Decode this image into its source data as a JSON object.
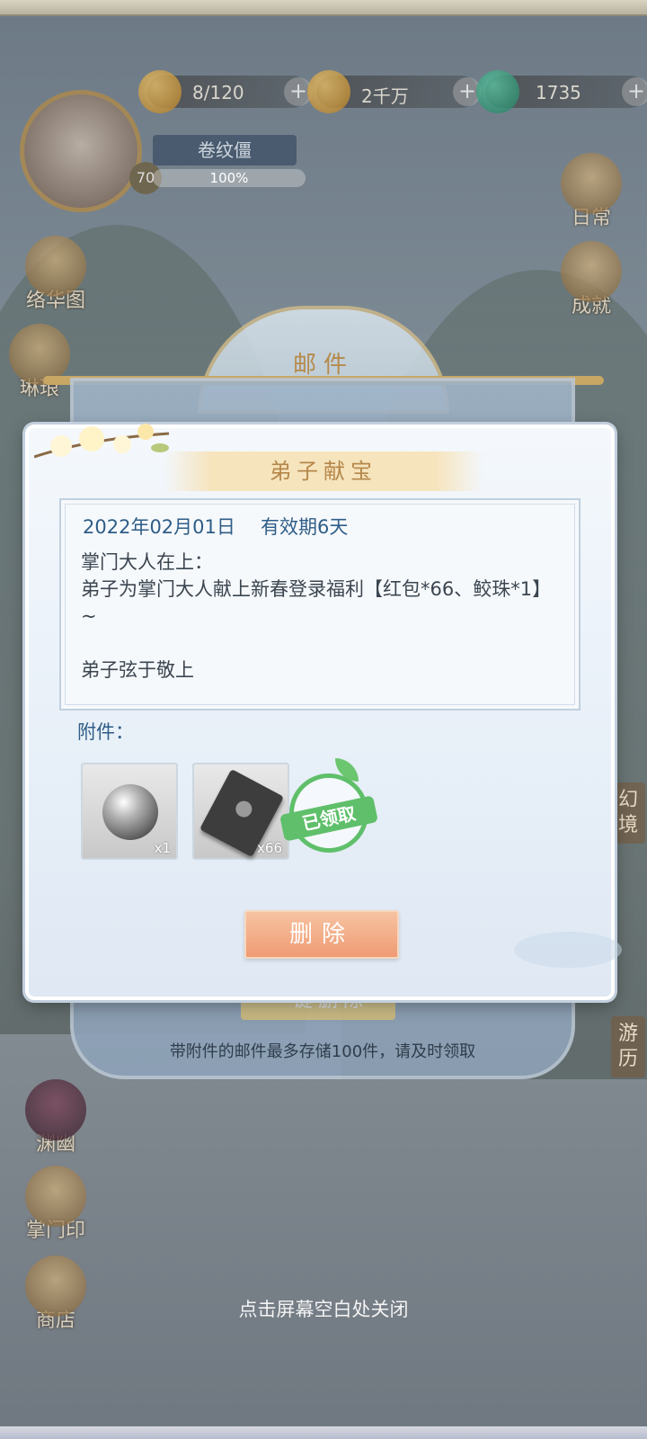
{
  "resources": [
    {
      "icon": "cat-coin-icon",
      "value": "8/120"
    },
    {
      "icon": "paw-coin-icon",
      "value": "2千万"
    },
    {
      "icon": "jade-icon",
      "value": "1735"
    }
  ],
  "avatar": {
    "level": "70",
    "title": "卷纹僵",
    "progress": "100%"
  },
  "left_nav": [
    {
      "label": "络华图"
    },
    {
      "label": "琳琅"
    },
    {
      "label": "渊幽"
    },
    {
      "label": "掌门印"
    },
    {
      "label": "商店"
    }
  ],
  "right_nav": [
    {
      "label": "日常"
    },
    {
      "label": "成就"
    },
    {
      "label": "幻境"
    },
    {
      "label": "游历"
    }
  ],
  "mail_panel": {
    "title": "邮件",
    "one_key_delete": "一键删除",
    "storage_tip": "带附件的邮件最多存储100件，请及时领取"
  },
  "dialog": {
    "title": "弟子献宝",
    "date": "2022年02月01日",
    "validity": "有效期6天",
    "body": "掌门大人在上：\n弟子为掌门大人献上新春登录福利【红包*66、鲛珠*1】~\n\n弟子弦于敬上",
    "attachments_label": "附件：",
    "attachments": [
      {
        "icon": "pearl-icon",
        "qty": "x1"
      },
      {
        "icon": "red-envelope-icon",
        "qty": "x66"
      }
    ],
    "claimed_stamp": "已领取",
    "delete_button": "删除"
  },
  "close_hint": "点击屏幕空白处关闭",
  "colors": {
    "accent_gold": "#b5874a",
    "text_blue": "#2f5d87",
    "delete_button": "#ef9b74",
    "claimed_green": "#5fbf6a"
  }
}
